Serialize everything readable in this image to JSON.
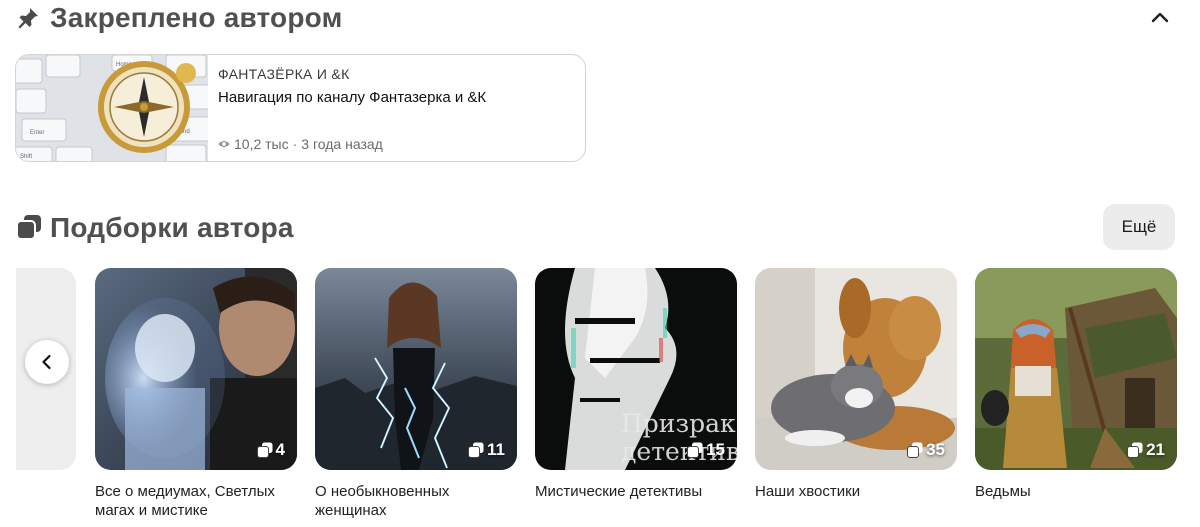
{
  "pinned": {
    "title": "Закреплено автором",
    "channel": "ФАНТАЗЁРКА И &К",
    "video_title": "Навигация по каналу Фантазерка и &К",
    "views": "10,2 тыс",
    "separator": "·",
    "age": "3 года назад",
    "icons": {
      "pin": "pin-icon",
      "collapse": "chevron-up-icon",
      "views": "eye-icon",
      "thumbnail": "keyboard-compass-thumbnail"
    }
  },
  "collections": {
    "title": "Подборки автора",
    "more_label": "Ещё",
    "icons": {
      "section": "stack-icon",
      "prev": "chevron-left-icon",
      "badge": "stack-icon"
    },
    "items": [
      {
        "title": "Все о медиумах, Светлых магах и мистике",
        "count": "4"
      },
      {
        "title": "О необыкновенных женщинах",
        "count": "11"
      },
      {
        "title": "Мистические детективы",
        "count": "15",
        "cover_caption": "Призрак детектив"
      },
      {
        "title": "Наши хвостики",
        "count": "35"
      },
      {
        "title": "Ведьмы",
        "count": "21"
      }
    ]
  },
  "colors": {
    "heading": "#505050",
    "card_border": "#d4d4d4",
    "button_bg": "#ececec"
  }
}
